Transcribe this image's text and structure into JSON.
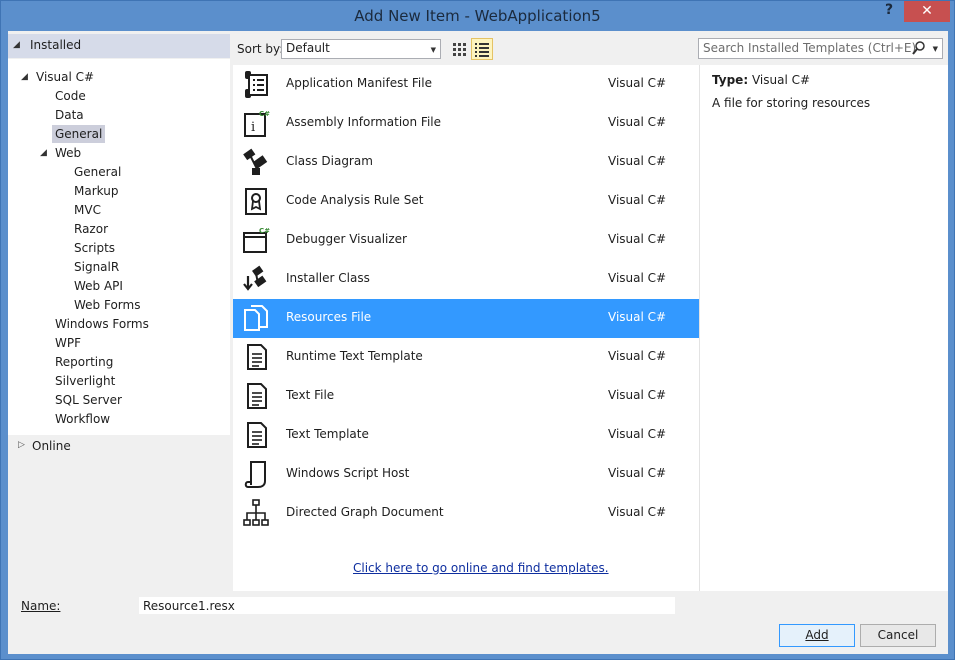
{
  "window": {
    "title": "Add New Item - WebApplication5",
    "help_label": "?",
    "close_label": "✕"
  },
  "tree": {
    "installed_label": "Installed",
    "online_label": "Online",
    "items": [
      {
        "label": "Visual C#",
        "level": 0,
        "expanded": true
      },
      {
        "label": "Code",
        "level": 1
      },
      {
        "label": "Data",
        "level": 1
      },
      {
        "label": "General",
        "level": 1,
        "selected": true
      },
      {
        "label": "Web",
        "level": 1,
        "expanded": true
      },
      {
        "label": "General",
        "level": 2
      },
      {
        "label": "Markup",
        "level": 2
      },
      {
        "label": "MVC",
        "level": 2
      },
      {
        "label": "Razor",
        "level": 2
      },
      {
        "label": "Scripts",
        "level": 2
      },
      {
        "label": "SignalR",
        "level": 2
      },
      {
        "label": "Web API",
        "level": 2
      },
      {
        "label": "Web Forms",
        "level": 2
      },
      {
        "label": "Windows Forms",
        "level": 1
      },
      {
        "label": "WPF",
        "level": 1
      },
      {
        "label": "Reporting",
        "level": 1
      },
      {
        "label": "Silverlight",
        "level": 1
      },
      {
        "label": "SQL Server",
        "level": 1
      },
      {
        "label": "Workflow",
        "level": 1
      }
    ]
  },
  "toolbar": {
    "sort_label": "Sort by:",
    "sort_value": "Default",
    "search_placeholder": "Search Installed Templates (Ctrl+E)"
  },
  "templates": [
    {
      "name": "Application Manifest File",
      "lang": "Visual C#",
      "icon": "manifest-icon"
    },
    {
      "name": "Assembly Information File",
      "lang": "Visual C#",
      "icon": "assembly-info-icon"
    },
    {
      "name": "Class Diagram",
      "lang": "Visual C#",
      "icon": "class-diagram-icon"
    },
    {
      "name": "Code Analysis Rule Set",
      "lang": "Visual C#",
      "icon": "rule-set-icon"
    },
    {
      "name": "Debugger Visualizer",
      "lang": "Visual C#",
      "icon": "debugger-visualizer-icon"
    },
    {
      "name": "Installer Class",
      "lang": "Visual C#",
      "icon": "installer-class-icon"
    },
    {
      "name": "Resources File",
      "lang": "Visual C#",
      "icon": "resources-file-icon",
      "selected": true
    },
    {
      "name": "Runtime Text Template",
      "lang": "Visual C#",
      "icon": "runtime-text-template-icon"
    },
    {
      "name": "Text File",
      "lang": "Visual C#",
      "icon": "text-file-icon"
    },
    {
      "name": "Text Template",
      "lang": "Visual C#",
      "icon": "text-template-icon"
    },
    {
      "name": "Windows Script Host",
      "lang": "Visual C#",
      "icon": "script-host-icon"
    },
    {
      "name": "Directed Graph Document",
      "lang": "Visual C#",
      "icon": "directed-graph-icon"
    }
  ],
  "online_link": "Click here to go online and find templates.",
  "detail": {
    "type_label": "Type:",
    "type_value": "Visual C#",
    "description": "A file for storing resources"
  },
  "form": {
    "name_label": "Name:",
    "name_value": "Resource1.resx",
    "add_label": "Add",
    "cancel_label": "Cancel"
  },
  "colors": {
    "selection": "#3399ff",
    "titlebar": "#5b8fcc",
    "close": "#c75050",
    "link": "#0e2e9f"
  }
}
